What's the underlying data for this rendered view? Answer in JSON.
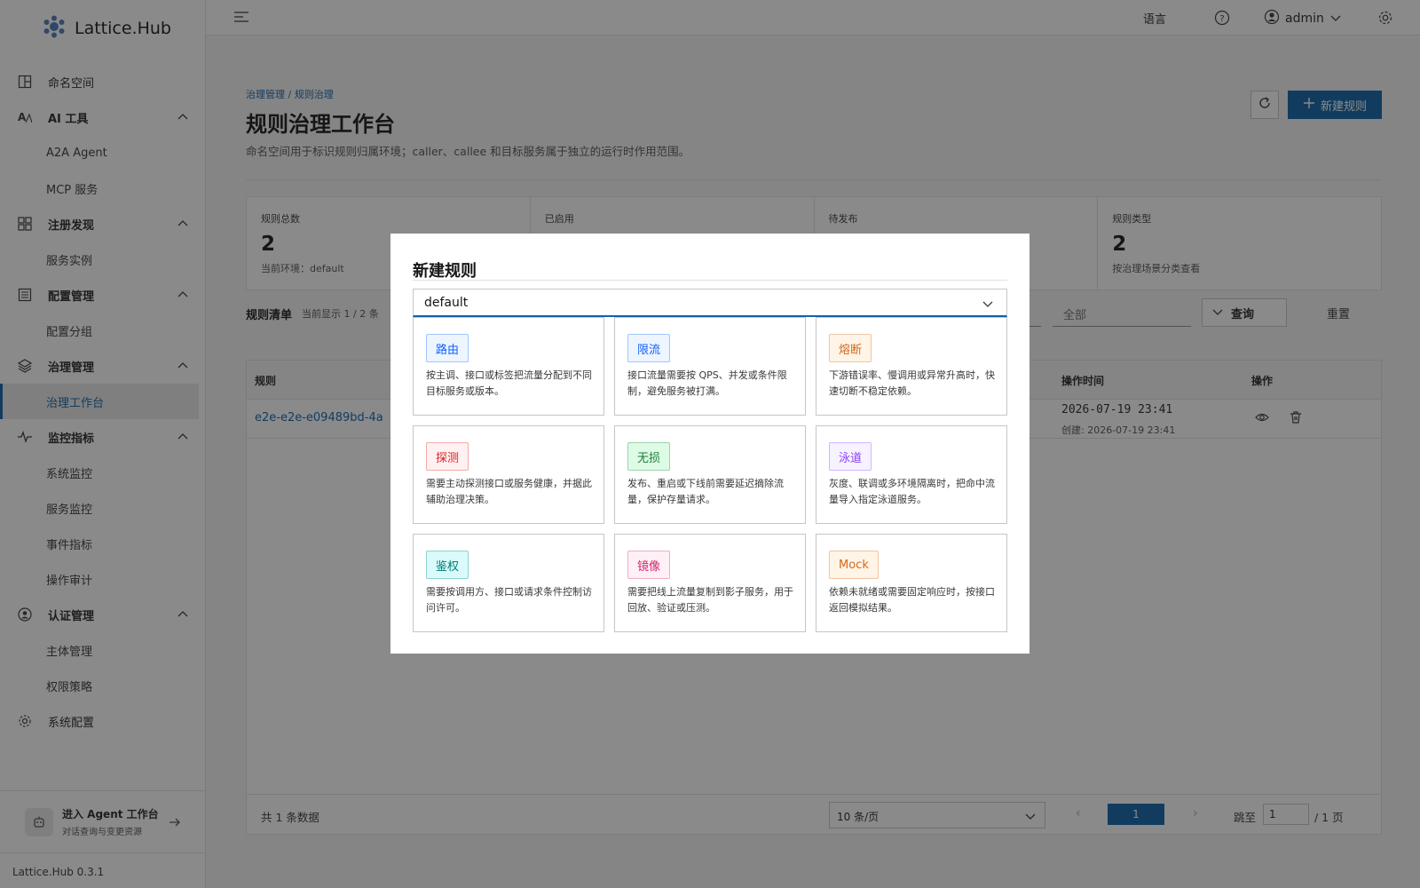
{
  "brand": {
    "name": "Lattice.Hub",
    "version": "Lattice.Hub 0.3.1"
  },
  "sidebar": {
    "items": [
      {
        "label": "命名空间",
        "icon": "namespace-icon",
        "type": "item"
      },
      {
        "label": "AI 工具",
        "icon": "ai-tools-icon",
        "type": "group"
      },
      {
        "label": "A2A Agent",
        "type": "sub"
      },
      {
        "label": "MCP 服务",
        "type": "sub"
      },
      {
        "label": "注册发现",
        "icon": "registry-icon",
        "type": "group"
      },
      {
        "label": "服务实例",
        "type": "sub"
      },
      {
        "label": "配置管理",
        "icon": "config-icon",
        "type": "group"
      },
      {
        "label": "配置分组",
        "type": "sub"
      },
      {
        "label": "治理管理",
        "icon": "governance-icon",
        "type": "group"
      },
      {
        "label": "治理工作台",
        "type": "sub",
        "active": true
      },
      {
        "label": "监控指标",
        "icon": "monitor-icon",
        "type": "group"
      },
      {
        "label": "系统监控",
        "type": "sub"
      },
      {
        "label": "服务监控",
        "type": "sub"
      },
      {
        "label": "事件指标",
        "type": "sub"
      },
      {
        "label": "操作审计",
        "type": "sub"
      },
      {
        "label": "认证管理",
        "icon": "auth-icon",
        "type": "group"
      },
      {
        "label": "主体管理",
        "type": "sub"
      },
      {
        "label": "权限策略",
        "type": "sub"
      },
      {
        "label": "系统配置",
        "icon": "gear-icon",
        "type": "item"
      }
    ],
    "agent_entry": {
      "title": "进入 Agent 工作台",
      "subtitle": "对话查询与变更资源"
    }
  },
  "header": {
    "language": "语言",
    "user": "admin"
  },
  "page": {
    "breadcrumb": "治理管理 / 规则治理",
    "title": "规则治理工作台",
    "description": "命名空间用于标识规则归属环境；caller、callee 和目标服务属于独立的运行时作用范围。",
    "new_button": "新建规则"
  },
  "stats": [
    {
      "label": "规则总数",
      "value": "2",
      "sub": "当前环境：default"
    },
    {
      "label": "已启用",
      "value": "",
      "sub": ""
    },
    {
      "label": "待发布",
      "value": "",
      "sub": ""
    },
    {
      "label": "规则类型",
      "value": "2",
      "sub": "按治理场景分类查看"
    }
  ],
  "list": {
    "title": "规则清单",
    "count": "当前显示 1 / 2 条",
    "filter_all": "全部",
    "query": "查询",
    "reset": "重置",
    "columns": {
      "rule": "规则",
      "op_time": "操作时间",
      "actions": "操作"
    },
    "rows": [
      {
        "rule": "e2e-e2e-e09489bd-4a",
        "op_time": "2026-07-19 23:41",
        "created": "创建: 2026-07-19 23:41"
      }
    ],
    "footer": {
      "total": "共 1 条数据",
      "page_size": "10 条/页",
      "current_page": "1",
      "jump_label": "跳至",
      "jump_value": "1",
      "total_pages": "/ 1 页"
    }
  },
  "modal": {
    "title": "新建规则",
    "namespace": "default",
    "cards": [
      {
        "tag": "路由",
        "desc": "按主调、接口或标签把流量分配到不同目标服务或版本。",
        "color": "#0f62fe",
        "bg": "#edf5ff"
      },
      {
        "tag": "限流",
        "desc": "接口流量需要按 QPS、并发或条件限制，避免服务被打满。",
        "color": "#0f62fe",
        "bg": "#edf5ff"
      },
      {
        "tag": "熔断",
        "desc": "下游错误率、慢调用或异常升高时，快速切断不稳定依赖。",
        "color": "#d2691e",
        "bg": "#fff4e5"
      },
      {
        "tag": "探测",
        "desc": "需要主动探测接口或服务健康，并据此辅助治理决策。",
        "color": "#da1e28",
        "bg": "#fff1f1"
      },
      {
        "tag": "无损",
        "desc": "发布、重启或下线前需要延迟摘除流量，保护存量请求。",
        "color": "#198038",
        "bg": "#defbe6"
      },
      {
        "tag": "泳道",
        "desc": "灰度、联调或多环境隔离时，把命中流量导入指定泳道服务。",
        "color": "#8a3ffc",
        "bg": "#f6f2ff"
      },
      {
        "tag": "鉴权",
        "desc": "需要按调用方、接口或请求条件控制访问许可。",
        "color": "#007d79",
        "bg": "#d9fbfb"
      },
      {
        "tag": "镜像",
        "desc": "需要把线上流量复制到影子服务，用于回放、验证或压测。",
        "color": "#d02670",
        "bg": "#fff0f7"
      },
      {
        "tag": "Mock",
        "desc": "依赖未就绪或需要固定响应时，按接口返回模拟结果。",
        "color": "#d2691e",
        "bg": "#fff4e5"
      }
    ]
  },
  "colors": {
    "primary": "#0f62a8",
    "overlay": "rgba(22,22,22,0.5)"
  }
}
